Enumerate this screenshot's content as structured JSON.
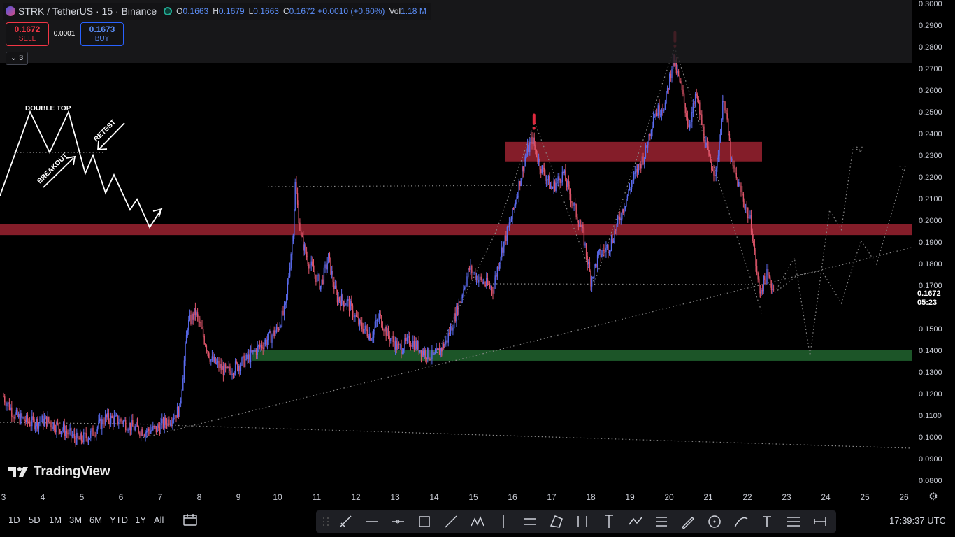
{
  "legend": {
    "symbol": "STRK / TetherUS · 15 · Binance",
    "open_label": "O",
    "open_value": "0.1663",
    "high_label": "H",
    "high_value": "0.1679",
    "low_label": "L",
    "low_value": "0.1663",
    "close_label": "C",
    "close_value": "0.1672",
    "change": "+0.0010 (+0.60%)",
    "vol_label": "Vol",
    "vol_value": "1.18 M"
  },
  "trade": {
    "sell_price": "0.1672",
    "sell_label": "SELL",
    "spread": "0.0001",
    "buy_price": "0.1673",
    "buy_label": "BUY"
  },
  "indicators_toggle": "3",
  "annotations": {
    "double_top": "DOUBLE TOP",
    "breakout": "BREAKOUT",
    "retest": "RETEST"
  },
  "price_axis": {
    "ticks": [
      "0.3000",
      "0.2900",
      "0.2800",
      "0.2700",
      "0.2600",
      "0.2500",
      "0.2400",
      "0.2300",
      "0.2200",
      "0.2100",
      "0.2000",
      "0.1900",
      "0.1800",
      "0.1700",
      "0.1600",
      "0.1500",
      "0.1400",
      "0.1300",
      "0.1200",
      "0.1100",
      "0.1000",
      "0.0900",
      "0.0800"
    ],
    "last_price": "0.1672",
    "countdown": "05:23"
  },
  "time_axis": {
    "ticks": [
      "3",
      "4",
      "5",
      "6",
      "7",
      "8",
      "9",
      "10",
      "11",
      "12",
      "13",
      "14",
      "15",
      "16",
      "17",
      "18",
      "19",
      "20",
      "21",
      "22",
      "23",
      "24",
      "25",
      "26"
    ]
  },
  "bottom_bar": {
    "ranges": [
      "1D",
      "5D",
      "1M",
      "3M",
      "6M",
      "YTD",
      "1Y",
      "All"
    ],
    "clock": "17:39:37 UTC"
  },
  "branding": {
    "logo_text": "TradingView"
  },
  "colors": {
    "background": "#000000",
    "up_candle": "#5b6cf0",
    "down_candle": "#e0566b",
    "resistance_zone": "#8b1f2b",
    "support_zone": "#1e5a2a",
    "signal_marker": "#e0293e",
    "guide_lines": "#8a8a8a"
  },
  "chart_data": {
    "type": "candlestick",
    "symbol": "STRK / TetherUS",
    "interval": "15",
    "exchange": "Binance",
    "x_unit": "day of month",
    "ylim": [
      0.075,
      0.302
    ],
    "xlim": [
      3.0,
      26.5
    ],
    "price_path": [
      [
        3.0,
        0.119
      ],
      [
        3.3,
        0.11
      ],
      [
        3.7,
        0.107
      ],
      [
        4.1,
        0.108
      ],
      [
        4.5,
        0.104
      ],
      [
        4.9,
        0.099
      ],
      [
        5.2,
        0.101
      ],
      [
        5.6,
        0.109
      ],
      [
        6.0,
        0.108
      ],
      [
        6.3,
        0.105
      ],
      [
        6.6,
        0.103
      ],
      [
        6.9,
        0.104
      ],
      [
        7.2,
        0.108
      ],
      [
        7.5,
        0.113
      ],
      [
        7.7,
        0.152
      ],
      [
        7.9,
        0.158
      ],
      [
        8.3,
        0.136
      ],
      [
        8.7,
        0.13
      ],
      [
        9.2,
        0.136
      ],
      [
        9.6,
        0.143
      ],
      [
        10.0,
        0.15
      ],
      [
        10.2,
        0.16
      ],
      [
        10.4,
        0.196
      ],
      [
        10.45,
        0.217
      ],
      [
        10.6,
        0.192
      ],
      [
        10.8,
        0.181
      ],
      [
        11.1,
        0.17
      ],
      [
        11.3,
        0.183
      ],
      [
        11.5,
        0.165
      ],
      [
        11.8,
        0.162
      ],
      [
        12.1,
        0.152
      ],
      [
        12.4,
        0.147
      ],
      [
        12.6,
        0.156
      ],
      [
        12.8,
        0.148
      ],
      [
        13.1,
        0.141
      ],
      [
        13.4,
        0.145
      ],
      [
        13.7,
        0.14
      ],
      [
        14.0,
        0.137
      ],
      [
        14.3,
        0.144
      ],
      [
        14.6,
        0.16
      ],
      [
        14.9,
        0.178
      ],
      [
        15.2,
        0.172
      ],
      [
        15.5,
        0.169
      ],
      [
        15.7,
        0.185
      ],
      [
        16.0,
        0.203
      ],
      [
        16.3,
        0.228
      ],
      [
        16.5,
        0.238
      ],
      [
        16.7,
        0.226
      ],
      [
        17.0,
        0.215
      ],
      [
        17.3,
        0.222
      ],
      [
        17.6,
        0.205
      ],
      [
        17.8,
        0.194
      ],
      [
        18.0,
        0.173
      ],
      [
        18.2,
        0.184
      ],
      [
        18.5,
        0.189
      ],
      [
        18.8,
        0.205
      ],
      [
        19.1,
        0.22
      ],
      [
        19.4,
        0.232
      ],
      [
        19.6,
        0.249
      ],
      [
        19.9,
        0.254
      ],
      [
        20.1,
        0.275
      ],
      [
        20.3,
        0.262
      ],
      [
        20.5,
        0.244
      ],
      [
        20.7,
        0.258
      ],
      [
        21.0,
        0.229
      ],
      [
        21.2,
        0.222
      ],
      [
        21.4,
        0.258
      ],
      [
        21.6,
        0.226
      ],
      [
        21.9,
        0.21
      ],
      [
        22.1,
        0.198
      ],
      [
        22.3,
        0.167
      ],
      [
        22.5,
        0.175
      ],
      [
        22.7,
        0.167
      ]
    ],
    "zones": [
      {
        "type": "resistance",
        "from": 0.2275,
        "to": 0.2365
      },
      {
        "type": "resistance",
        "from": 0.1935,
        "to": 0.1985
      },
      {
        "type": "support",
        "from": 0.1355,
        "to": 0.1405
      }
    ],
    "signals": [
      {
        "x": 16.55,
        "price": 0.2495
      },
      {
        "x": 20.15,
        "price": 0.2875
      }
    ],
    "projection": [
      [
        22.7,
        0.167
      ],
      [
        23.2,
        0.183
      ],
      [
        23.6,
        0.138
      ],
      [
        24.1,
        0.205
      ],
      [
        24.4,
        0.196
      ],
      [
        24.7,
        0.234
      ],
      [
        24.9,
        0.232
      ]
    ],
    "projection_alt": [
      [
        22.7,
        0.167
      ],
      [
        23.3,
        0.175
      ],
      [
        23.9,
        0.177
      ],
      [
        24.4,
        0.162
      ],
      [
        24.9,
        0.191
      ],
      [
        25.3,
        0.18
      ],
      [
        26.0,
        0.223
      ]
    ]
  }
}
